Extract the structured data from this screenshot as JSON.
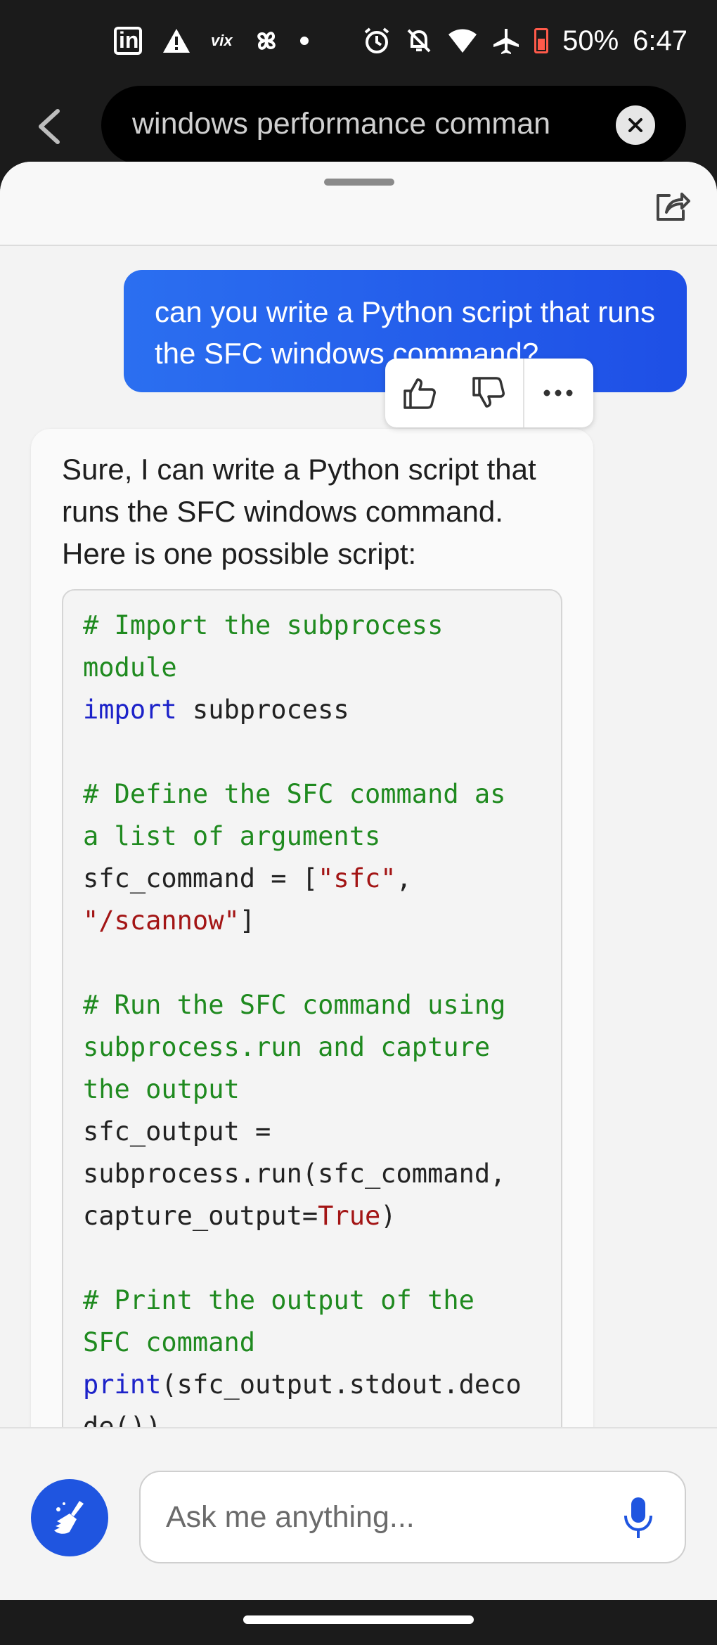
{
  "status_bar": {
    "battery": "50%",
    "time": "6:47",
    "left_icons": [
      "linkedin-icon",
      "warning-icon",
      "vix-icon",
      "pinwheel-icon",
      "dot-icon"
    ],
    "right_icons": [
      "alarm-icon",
      "mute-icon",
      "wifi-icon",
      "airplane-icon",
      "battery-icon"
    ]
  },
  "search": {
    "query": "windows performance comman"
  },
  "chat": {
    "user_message": "can you write a Python script that runs the SFC windows command?",
    "bot_intro": "Sure, I can write a Python script that runs the SFC windows command. Here is one possible script:",
    "code_lines": [
      [
        {
          "t": "# Import the subprocess",
          "c": "comment"
        }
      ],
      [
        {
          "t": "module",
          "c": "comment"
        }
      ],
      [
        {
          "t": "import",
          "c": "kw"
        },
        {
          "t": " subprocess",
          "c": "plain"
        }
      ],
      [],
      [
        {
          "t": "# Define the SFC command as",
          "c": "comment"
        }
      ],
      [
        {
          "t": "a list of arguments",
          "c": "comment"
        }
      ],
      [
        {
          "t": "sfc_command = [",
          "c": "plain"
        },
        {
          "t": "\"sfc\"",
          "c": "str"
        },
        {
          "t": ",",
          "c": "plain"
        }
      ],
      [
        {
          "t": "\"/scannow\"",
          "c": "str"
        },
        {
          "t": "]",
          "c": "plain"
        }
      ],
      [],
      [
        {
          "t": "# Run the SFC command using",
          "c": "comment"
        }
      ],
      [
        {
          "t": "subprocess.run and capture",
          "c": "comment"
        }
      ],
      [
        {
          "t": "the output",
          "c": "comment"
        }
      ],
      [
        {
          "t": "sfc_output =",
          "c": "plain"
        }
      ],
      [
        {
          "t": "subprocess.run(sfc_command,",
          "c": "plain"
        }
      ],
      [
        {
          "t": "capture_output=",
          "c": "plain"
        },
        {
          "t": "True",
          "c": "str"
        },
        {
          "t": ")",
          "c": "plain"
        }
      ],
      [],
      [
        {
          "t": "# Print the output of the",
          "c": "comment"
        }
      ],
      [
        {
          "t": "SFC command",
          "c": "comment"
        }
      ],
      [
        {
          "t": "print",
          "c": "kw"
        },
        {
          "t": "(sfc_output.stdout.deco",
          "c": "plain"
        }
      ],
      [
        {
          "t": "de())",
          "c": "plain"
        }
      ]
    ]
  },
  "input": {
    "placeholder": "Ask me anything..."
  },
  "colors": {
    "accent": "#1e4fe6",
    "comment": "#1f8a1f",
    "keyword": "#1c22c9",
    "string": "#a31515"
  }
}
